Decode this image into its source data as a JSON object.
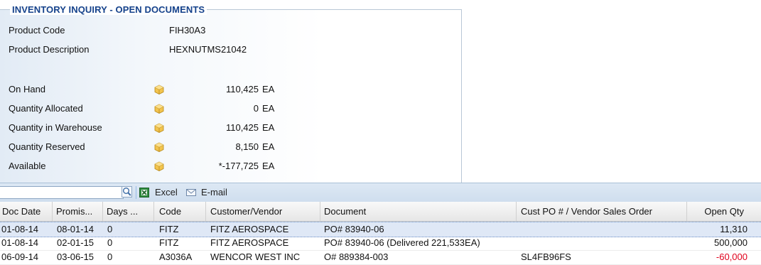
{
  "panel": {
    "title": "INVENTORY INQUIRY - OPEN DOCUMENTS",
    "product_code_label": "Product Code",
    "product_code": "FIH30A3",
    "product_description_label": "Product Description",
    "product_description": "HEXNUTMS21042",
    "quantities": [
      {
        "label": "On Hand",
        "value": "110,425",
        "unit": "EA",
        "icon": "box-icon"
      },
      {
        "label": "Quantity Allocated",
        "value": "0",
        "unit": "EA",
        "icon": "box-icon"
      },
      {
        "label": "Quantity in Warehouse",
        "value": "110,425",
        "unit": "EA",
        "icon": "box-icon"
      },
      {
        "label": "Quantity Reserved",
        "value": "8,150",
        "unit": "EA",
        "icon": "box-icon"
      },
      {
        "label": "Available",
        "value": "*-177,725",
        "unit": "EA",
        "icon": "box-icon"
      }
    ]
  },
  "toolbar": {
    "search_value": "",
    "search_icon": "search-icon",
    "excel_label": "Excel",
    "excel_icon": "excel-icon",
    "email_label": "E-mail",
    "email_icon": "envelope-icon"
  },
  "grid": {
    "columns": [
      "Doc Date",
      "Promis...",
      "Days ...",
      "Code",
      "Customer/Vendor",
      "Document",
      "Cust PO # / Vendor Sales Order",
      "Open Qty"
    ],
    "rows": [
      {
        "doc_date": "01-08-14",
        "promised": "08-01-14",
        "days": "0",
        "code": "FITZ",
        "customer": "FITZ AEROSPACE",
        "document": "PO# 83940-06",
        "cust_po": "",
        "open_qty": "11,310",
        "negative": false,
        "selected": true
      },
      {
        "doc_date": "01-08-14",
        "promised": "02-01-15",
        "days": "0",
        "code": "FITZ",
        "customer": "FITZ AEROSPACE",
        "document": "PO# 83940-06 (Delivered 221,533EA)",
        "cust_po": "",
        "open_qty": "500,000",
        "negative": false,
        "selected": false
      },
      {
        "doc_date": "06-09-14",
        "promised": "03-06-15",
        "days": "0",
        "code": "A3036A",
        "customer": "WENCOR WEST INC",
        "document": "O# 889384-003",
        "cust_po": "SL4FB96FS",
        "open_qty": "-60,000",
        "negative": true,
        "selected": false
      }
    ]
  },
  "colors": {
    "title": "#15428b",
    "negative": "#e0001b",
    "selected_row": "#dfe8f6"
  }
}
